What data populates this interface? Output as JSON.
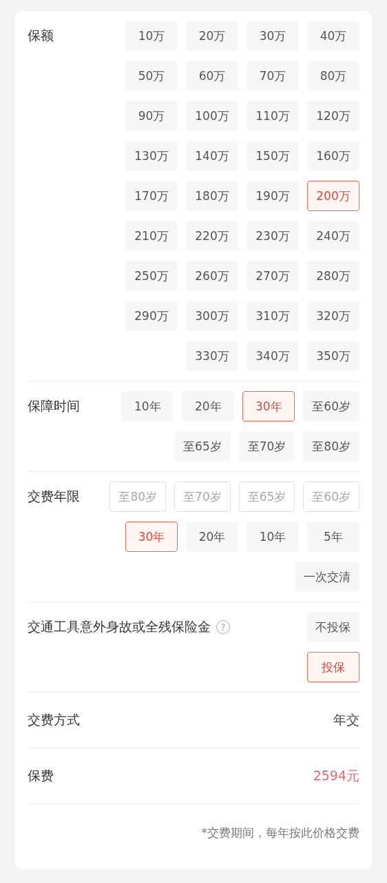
{
  "sections": [
    {
      "kind": "options",
      "label": "保额",
      "options": [
        {
          "label": "10万",
          "selected": false,
          "disabled": false
        },
        {
          "label": "20万",
          "selected": false,
          "disabled": false
        },
        {
          "label": "30万",
          "selected": false,
          "disabled": false
        },
        {
          "label": "40万",
          "selected": false,
          "disabled": false
        },
        {
          "label": "50万",
          "selected": false,
          "disabled": false
        },
        {
          "label": "60万",
          "selected": false,
          "disabled": false
        },
        {
          "label": "70万",
          "selected": false,
          "disabled": false
        },
        {
          "label": "80万",
          "selected": false,
          "disabled": false
        },
        {
          "label": "90万",
          "selected": false,
          "disabled": false
        },
        {
          "label": "100万",
          "selected": false,
          "disabled": false
        },
        {
          "label": "110万",
          "selected": false,
          "disabled": false
        },
        {
          "label": "120万",
          "selected": false,
          "disabled": false
        },
        {
          "label": "130万",
          "selected": false,
          "disabled": false
        },
        {
          "label": "140万",
          "selected": false,
          "disabled": false
        },
        {
          "label": "150万",
          "selected": false,
          "disabled": false
        },
        {
          "label": "160万",
          "selected": false,
          "disabled": false
        },
        {
          "label": "170万",
          "selected": false,
          "disabled": false
        },
        {
          "label": "180万",
          "selected": false,
          "disabled": false
        },
        {
          "label": "190万",
          "selected": false,
          "disabled": false
        },
        {
          "label": "200万",
          "selected": true,
          "disabled": false
        },
        {
          "label": "210万",
          "selected": false,
          "disabled": false
        },
        {
          "label": "220万",
          "selected": false,
          "disabled": false
        },
        {
          "label": "230万",
          "selected": false,
          "disabled": false
        },
        {
          "label": "240万",
          "selected": false,
          "disabled": false
        },
        {
          "label": "250万",
          "selected": false,
          "disabled": false
        },
        {
          "label": "260万",
          "selected": false,
          "disabled": false
        },
        {
          "label": "270万",
          "selected": false,
          "disabled": false
        },
        {
          "label": "280万",
          "selected": false,
          "disabled": false
        },
        {
          "label": "290万",
          "selected": false,
          "disabled": false
        },
        {
          "label": "300万",
          "selected": false,
          "disabled": false
        },
        {
          "label": "310万",
          "selected": false,
          "disabled": false
        },
        {
          "label": "320万",
          "selected": false,
          "disabled": false
        },
        {
          "label": "330万",
          "selected": false,
          "disabled": false
        },
        {
          "label": "340万",
          "selected": false,
          "disabled": false
        },
        {
          "label": "350万",
          "selected": false,
          "disabled": false
        }
      ]
    },
    {
      "kind": "options",
      "label": "保障时间",
      "options": [
        {
          "label": "10年",
          "selected": false,
          "disabled": false
        },
        {
          "label": "20年",
          "selected": false,
          "disabled": false
        },
        {
          "label": "30年",
          "selected": true,
          "disabled": false
        },
        {
          "label": "至60岁",
          "selected": false,
          "disabled": false
        },
        {
          "label": "至65岁",
          "selected": false,
          "disabled": false
        },
        {
          "label": "至70岁",
          "selected": false,
          "disabled": false
        },
        {
          "label": "至80岁",
          "selected": false,
          "disabled": false
        }
      ]
    },
    {
      "kind": "options",
      "label": "交费年限",
      "options": [
        {
          "label": "至80岁",
          "selected": false,
          "disabled": true
        },
        {
          "label": "至70岁",
          "selected": false,
          "disabled": true
        },
        {
          "label": "至65岁",
          "selected": false,
          "disabled": true
        },
        {
          "label": "至60岁",
          "selected": false,
          "disabled": true
        },
        {
          "label": "30年",
          "selected": true,
          "disabled": false
        },
        {
          "label": "20年",
          "selected": false,
          "disabled": false
        },
        {
          "label": "10年",
          "selected": false,
          "disabled": false
        },
        {
          "label": "5年",
          "selected": false,
          "disabled": false
        },
        {
          "label": "一次交清",
          "selected": false,
          "disabled": false
        }
      ]
    },
    {
      "kind": "stack",
      "label": "交通工具意外身故或全残保险金",
      "help": "?",
      "options": [
        {
          "label": "不投保",
          "selected": false,
          "disabled": false
        },
        {
          "label": "投保",
          "selected": true,
          "disabled": false
        }
      ]
    },
    {
      "kind": "value",
      "label": "交费方式",
      "value": "年交"
    },
    {
      "kind": "price",
      "label": "保费",
      "value": "2594元"
    }
  ],
  "note": "*交费期间，每年按此价格交费"
}
